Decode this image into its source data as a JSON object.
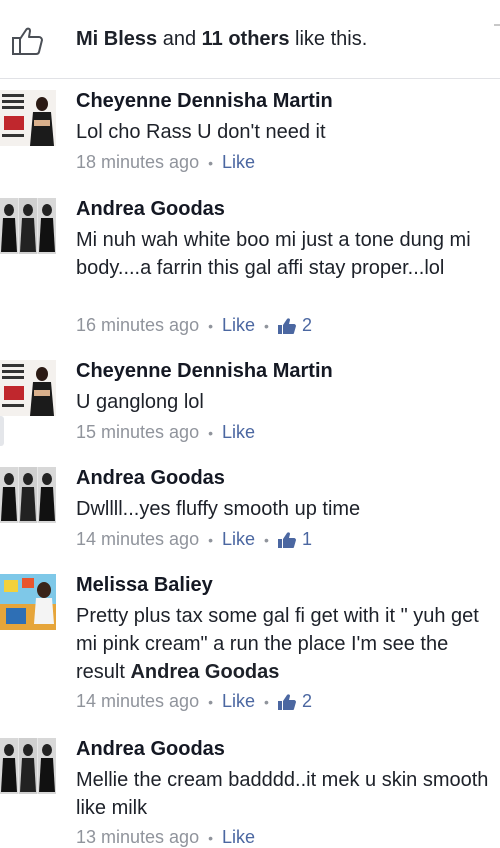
{
  "likes_bar": {
    "first_liker": "Mi Bless",
    "and_text": " and ",
    "others": "11 others",
    "suffix": " like this."
  },
  "comments": [
    {
      "author": "Cheyenne Dennisha Martin",
      "text": "Lol cho Rass U don't need it",
      "time": "18 minutes ago",
      "like_label": "Like",
      "likes": ""
    },
    {
      "author": "Andrea Goodas",
      "text": "Mi nuh wah white boo mi just a tone dung mi body....a farrin this gal affi stay proper...lol",
      "time": "16 minutes ago",
      "like_label": "Like",
      "likes": "2"
    },
    {
      "author": "Cheyenne Dennisha Martin",
      "text": "U ganglong lol",
      "time": "15 minutes ago",
      "like_label": "Like",
      "likes": ""
    },
    {
      "author": "Andrea Goodas",
      "text": "Dwllll...yes fluffy smooth up time",
      "time": "14 minutes ago",
      "like_label": "Like",
      "likes": "1"
    },
    {
      "author": "Melissa Baliey",
      "text": "Pretty plus tax some gal fi get with it \" yuh get mi pink cream\" a run the place I'm see the result ",
      "mention": "Andrea Goodas",
      "time": "14 minutes ago",
      "like_label": "Like",
      "likes": "2"
    },
    {
      "author": "Andrea Goodas",
      "text": "Mellie the cream badddd..it mek u skin smooth like milk",
      "time": "13 minutes ago",
      "like_label": "Like",
      "likes": ""
    }
  ]
}
